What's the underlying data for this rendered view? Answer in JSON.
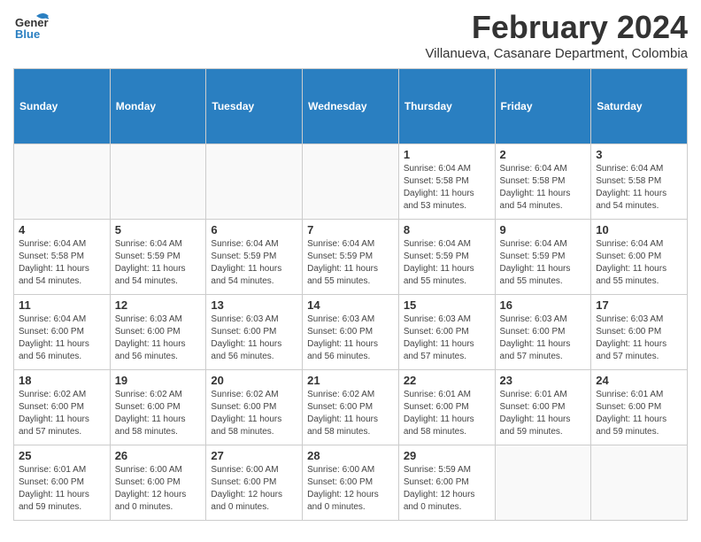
{
  "header": {
    "logo_general": "General",
    "logo_blue": "Blue",
    "month_title": "February 2024",
    "location": "Villanueva, Casanare Department, Colombia"
  },
  "weekdays": [
    "Sunday",
    "Monday",
    "Tuesday",
    "Wednesday",
    "Thursday",
    "Friday",
    "Saturday"
  ],
  "weeks": [
    [
      {
        "day": "",
        "info": ""
      },
      {
        "day": "",
        "info": ""
      },
      {
        "day": "",
        "info": ""
      },
      {
        "day": "",
        "info": ""
      },
      {
        "day": "1",
        "info": "Sunrise: 6:04 AM\nSunset: 5:58 PM\nDaylight: 11 hours and 53 minutes."
      },
      {
        "day": "2",
        "info": "Sunrise: 6:04 AM\nSunset: 5:58 PM\nDaylight: 11 hours and 54 minutes."
      },
      {
        "day": "3",
        "info": "Sunrise: 6:04 AM\nSunset: 5:58 PM\nDaylight: 11 hours and 54 minutes."
      }
    ],
    [
      {
        "day": "4",
        "info": "Sunrise: 6:04 AM\nSunset: 5:58 PM\nDaylight: 11 hours and 54 minutes."
      },
      {
        "day": "5",
        "info": "Sunrise: 6:04 AM\nSunset: 5:59 PM\nDaylight: 11 hours and 54 minutes."
      },
      {
        "day": "6",
        "info": "Sunrise: 6:04 AM\nSunset: 5:59 PM\nDaylight: 11 hours and 54 minutes."
      },
      {
        "day": "7",
        "info": "Sunrise: 6:04 AM\nSunset: 5:59 PM\nDaylight: 11 hours and 55 minutes."
      },
      {
        "day": "8",
        "info": "Sunrise: 6:04 AM\nSunset: 5:59 PM\nDaylight: 11 hours and 55 minutes."
      },
      {
        "day": "9",
        "info": "Sunrise: 6:04 AM\nSunset: 5:59 PM\nDaylight: 11 hours and 55 minutes."
      },
      {
        "day": "10",
        "info": "Sunrise: 6:04 AM\nSunset: 6:00 PM\nDaylight: 11 hours and 55 minutes."
      }
    ],
    [
      {
        "day": "11",
        "info": "Sunrise: 6:04 AM\nSunset: 6:00 PM\nDaylight: 11 hours and 56 minutes."
      },
      {
        "day": "12",
        "info": "Sunrise: 6:03 AM\nSunset: 6:00 PM\nDaylight: 11 hours and 56 minutes."
      },
      {
        "day": "13",
        "info": "Sunrise: 6:03 AM\nSunset: 6:00 PM\nDaylight: 11 hours and 56 minutes."
      },
      {
        "day": "14",
        "info": "Sunrise: 6:03 AM\nSunset: 6:00 PM\nDaylight: 11 hours and 56 minutes."
      },
      {
        "day": "15",
        "info": "Sunrise: 6:03 AM\nSunset: 6:00 PM\nDaylight: 11 hours and 57 minutes."
      },
      {
        "day": "16",
        "info": "Sunrise: 6:03 AM\nSunset: 6:00 PM\nDaylight: 11 hours and 57 minutes."
      },
      {
        "day": "17",
        "info": "Sunrise: 6:03 AM\nSunset: 6:00 PM\nDaylight: 11 hours and 57 minutes."
      }
    ],
    [
      {
        "day": "18",
        "info": "Sunrise: 6:02 AM\nSunset: 6:00 PM\nDaylight: 11 hours and 57 minutes."
      },
      {
        "day": "19",
        "info": "Sunrise: 6:02 AM\nSunset: 6:00 PM\nDaylight: 11 hours and 58 minutes."
      },
      {
        "day": "20",
        "info": "Sunrise: 6:02 AM\nSunset: 6:00 PM\nDaylight: 11 hours and 58 minutes."
      },
      {
        "day": "21",
        "info": "Sunrise: 6:02 AM\nSunset: 6:00 PM\nDaylight: 11 hours and 58 minutes."
      },
      {
        "day": "22",
        "info": "Sunrise: 6:01 AM\nSunset: 6:00 PM\nDaylight: 11 hours and 58 minutes."
      },
      {
        "day": "23",
        "info": "Sunrise: 6:01 AM\nSunset: 6:00 PM\nDaylight: 11 hours and 59 minutes."
      },
      {
        "day": "24",
        "info": "Sunrise: 6:01 AM\nSunset: 6:00 PM\nDaylight: 11 hours and 59 minutes."
      }
    ],
    [
      {
        "day": "25",
        "info": "Sunrise: 6:01 AM\nSunset: 6:00 PM\nDaylight: 11 hours and 59 minutes."
      },
      {
        "day": "26",
        "info": "Sunrise: 6:00 AM\nSunset: 6:00 PM\nDaylight: 12 hours and 0 minutes."
      },
      {
        "day": "27",
        "info": "Sunrise: 6:00 AM\nSunset: 6:00 PM\nDaylight: 12 hours and 0 minutes."
      },
      {
        "day": "28",
        "info": "Sunrise: 6:00 AM\nSunset: 6:00 PM\nDaylight: 12 hours and 0 minutes."
      },
      {
        "day": "29",
        "info": "Sunrise: 5:59 AM\nSunset: 6:00 PM\nDaylight: 12 hours and 0 minutes."
      },
      {
        "day": "",
        "info": ""
      },
      {
        "day": "",
        "info": ""
      }
    ]
  ]
}
